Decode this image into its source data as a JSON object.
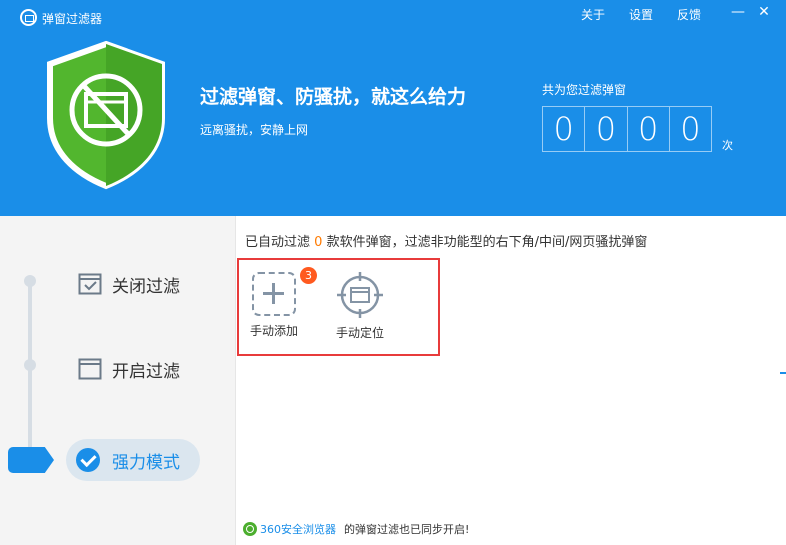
{
  "app": {
    "title": "弹窗过滤器"
  },
  "menu": {
    "about": "关于",
    "settings": "设置",
    "feedback": "反馈",
    "minimize": "—",
    "close": "✕"
  },
  "banner": {
    "headline": "过滤弹窗、防骚扰，就这么给力",
    "subline": "远离骚扰，安静上网",
    "counter_label": "共为您过滤弹窗",
    "counter_digits": [
      "0",
      "0",
      "0",
      "0"
    ],
    "counter_unit": "次"
  },
  "modes": {
    "off": "关闭过滤",
    "on": "开启过滤",
    "strong": "强力模式",
    "active": "strong"
  },
  "info": {
    "prefix": "已自动过滤",
    "count": "0",
    "suffix": "款软件弹窗，过滤非功能型的右下角/中间/网页骚扰弹窗"
  },
  "tools": {
    "manual_add": {
      "label": "手动添加",
      "badge": "3"
    },
    "manual_locate": {
      "label": "手动定位"
    }
  },
  "footer": {
    "browser_link": "360安全浏览器",
    "text": "的弹窗过滤也已同步开启!"
  },
  "colors": {
    "accent": "#1a8ee8",
    "shield": "#52b62e",
    "highlight": "#e83b3b",
    "count": "#ff7a00"
  }
}
